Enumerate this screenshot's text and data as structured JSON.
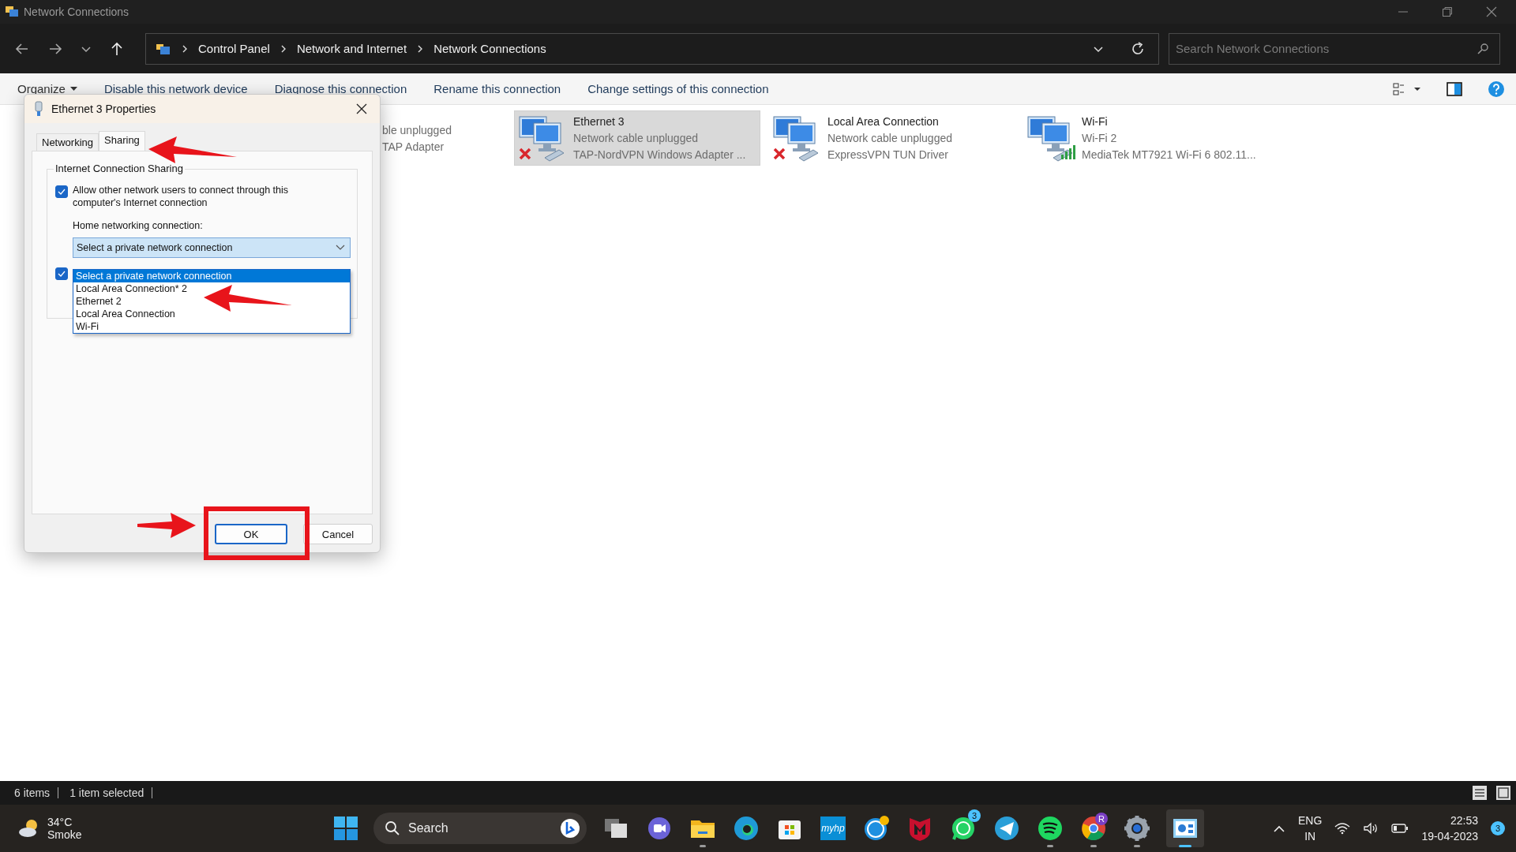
{
  "window": {
    "title": "Network Connections"
  },
  "address_bar": {
    "breadcrumbs": [
      "Control Panel",
      "Network and Internet",
      "Network Connections"
    ]
  },
  "search": {
    "placeholder": "Search Network Connections"
  },
  "command_bar": {
    "items": [
      {
        "label": "Organize",
        "kind": "menu"
      },
      {
        "label": "Disable this network device",
        "kind": "link"
      },
      {
        "label": "Diagnose this connection",
        "kind": "link"
      },
      {
        "label": "Rename this connection",
        "kind": "link"
      },
      {
        "label": "Change settings of this connection",
        "kind": "link"
      }
    ]
  },
  "connections": [
    {
      "kind": "partial",
      "status": "ble unplugged",
      "device": "TAP Adapter"
    },
    {
      "kind": "full",
      "name": "Ethernet 3",
      "status": "Network cable unplugged",
      "device": "TAP-NordVPN Windows Adapter ...",
      "selected": true,
      "connected": false
    },
    {
      "kind": "full",
      "name": "Local Area Connection",
      "status": "Network cable unplugged",
      "device": "ExpressVPN TUN Driver",
      "selected": false,
      "connected": false
    },
    {
      "kind": "full",
      "name": "Wi-Fi",
      "status": "Wi-Fi 2",
      "device": "MediaTek MT7921 Wi-Fi 6 802.11...",
      "selected": false,
      "connected": true
    }
  ],
  "dialog": {
    "title": "Ethernet 3 Properties",
    "tabs": [
      {
        "label": "Networking",
        "selected": false
      },
      {
        "label": "Sharing",
        "selected": true
      }
    ],
    "group_title": "Internet Connection Sharing",
    "allow_sharing": {
      "label": "Allow other network users to connect through this computer's Internet connection",
      "checked": true
    },
    "home_connection": {
      "label": "Home networking connection:",
      "value": "Select a private network connection",
      "expanded": true,
      "options": [
        {
          "label": "Select a private network connection",
          "selected": true
        },
        {
          "label": "Local Area Connection* 2",
          "selected": false
        },
        {
          "label": "Ethernet 2",
          "selected": false
        },
        {
          "label": "Local Area Connection",
          "selected": false
        },
        {
          "label": "Wi-Fi",
          "selected": false
        }
      ]
    },
    "second_checkbox": {
      "checked": true
    },
    "buttons": [
      {
        "label": "OK",
        "default": true
      },
      {
        "label": "Cancel",
        "default": false
      }
    ]
  },
  "status_bar": {
    "items": [
      "6 items",
      "1 item selected"
    ]
  },
  "taskbar": {
    "weather": {
      "temperature": "34°C",
      "condition": "Smoke"
    },
    "search": {
      "label": "Search"
    },
    "apps": [
      {
        "kind": "taskview",
        "running": false,
        "active": false
      },
      {
        "kind": "chat",
        "running": false,
        "active": false
      },
      {
        "kind": "folder",
        "running": true,
        "active": false
      },
      {
        "kind": "edge",
        "running": false,
        "active": false
      },
      {
        "kind": "store",
        "running": false,
        "active": false
      },
      {
        "kind": "myhp",
        "label": "myhp",
        "running": false,
        "active": false
      },
      {
        "kind": "help",
        "running": false,
        "active": false
      },
      {
        "kind": "shield",
        "running": false,
        "active": false
      },
      {
        "kind": "whatsapp",
        "badge": "3",
        "running": false,
        "active": false
      },
      {
        "kind": "telegram",
        "running": false,
        "active": false
      },
      {
        "kind": "spotify",
        "running": true,
        "active": false
      },
      {
        "kind": "chrome",
        "badge": "R",
        "running": true,
        "active": false
      },
      {
        "kind": "settings",
        "running": true,
        "active": false
      },
      {
        "kind": "controlpanel",
        "running": true,
        "active": true
      }
    ],
    "language": [
      "ENG",
      "IN"
    ],
    "time": "22:53",
    "date": "19-04-2023",
    "notifications": "3"
  }
}
